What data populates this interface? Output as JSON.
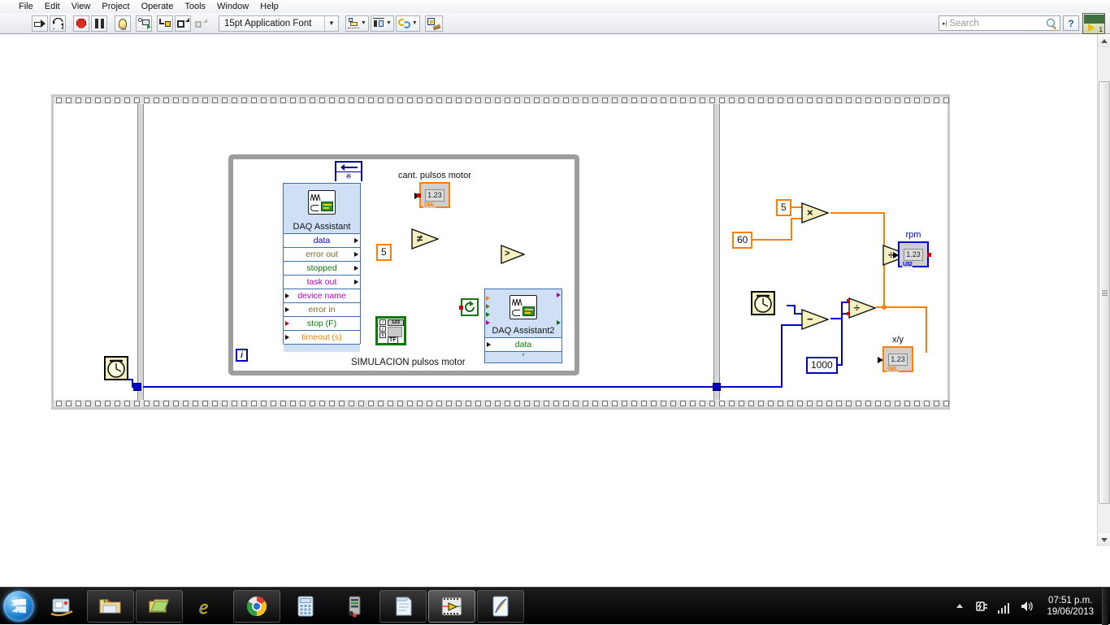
{
  "window": {
    "app": "LabVIEW Block Diagram",
    "menu": [
      "File",
      "Edit",
      "View",
      "Project",
      "Operate",
      "Tools",
      "Window",
      "Help"
    ]
  },
  "toolbar": {
    "buttons": [
      {
        "name": "run-button",
        "icon": "run-arrow-icon",
        "tip": "Run"
      },
      {
        "name": "run-continuously-button",
        "icon": "run-continuously-icon",
        "tip": "Run Continuously"
      },
      {
        "name": "abort-button",
        "icon": "abort-stop-icon",
        "tip": "Abort Execution"
      },
      {
        "name": "pause-button",
        "icon": "pause-icon",
        "tip": "Pause"
      },
      {
        "name": "highlight-execution-button",
        "icon": "lightbulb-icon",
        "tip": "Highlight Execution"
      },
      {
        "name": "retain-wire-values-button",
        "icon": "retain-wire-values-icon",
        "tip": "Retain Wire Values"
      },
      {
        "name": "step-into-button",
        "icon": "step-into-icon",
        "tip": "Step Into"
      },
      {
        "name": "step-over-button",
        "icon": "step-over-icon",
        "tip": "Step Over"
      },
      {
        "name": "step-out-button",
        "icon": "step-out-icon",
        "tip": "Step Out"
      }
    ],
    "font_selector": {
      "value": "15pt Application Font",
      "caret": "▼"
    },
    "align_label": "Align Objects",
    "distribute_label": "Distribute Objects",
    "reorder_label": "Reorder",
    "cleanup_label": "Clean Up Diagram"
  },
  "search": {
    "placeholder": "Search",
    "prefix": "▸|",
    "icon": "magnifier-icon"
  },
  "help_button": {
    "label": "?",
    "name": "context-help-button"
  },
  "vi_icon": {
    "connector_number": "1"
  },
  "diagram": {
    "structure": "flat-sequence",
    "frames": 3,
    "while_loop": {
      "label": "SIMULACION pulsos motor",
      "iteration_terminal": "i",
      "feedback_node_symbol": "※"
    },
    "express_vis": [
      {
        "name": "daq-assistant-1",
        "title": "DAQ Assistant",
        "terminals": [
          {
            "label": "data",
            "color": "#0000c8",
            "side": "out"
          },
          {
            "label": "error out",
            "color": "#7a6a20",
            "side": "out"
          },
          {
            "label": "stopped",
            "color": "#0a7a0a",
            "side": "out"
          },
          {
            "label": "task out",
            "color": "#b000b0",
            "side": "out"
          },
          {
            "label": "device name",
            "color": "#c000c0",
            "side": "in"
          },
          {
            "label": "error in",
            "color": "#7a6a20",
            "side": "in"
          },
          {
            "label": "stop (F)",
            "color": "#0a7a0a",
            "side": "in"
          },
          {
            "label": "timeout (s)",
            "color": "#ff8000",
            "side": "in"
          }
        ]
      },
      {
        "name": "daq-assistant-2",
        "title": "DAQ Assistant2",
        "terminals": [
          {
            "label": "data",
            "color": "#0a7a0a",
            "side": "in"
          }
        ]
      }
    ],
    "indicators": [
      {
        "name": "cant-pulsos-motor-indicator",
        "label": "cant. pulsos motor",
        "value": "1.23",
        "type": "DBL",
        "accent": "#ff8000"
      },
      {
        "name": "rpm-indicator",
        "label": "rpm",
        "value": "1.23",
        "type": "U32",
        "accent": "#0000d0"
      },
      {
        "name": "x-over-y-indicator",
        "label": "x/y",
        "value": "1.23",
        "type": "DBL",
        "accent": "#ff8000"
      }
    ],
    "constants": [
      {
        "name": "constant-5-loop",
        "value": "5",
        "accent": "#ff8000"
      },
      {
        "name": "constant-5-right",
        "value": "5",
        "accent": "#ff8000"
      },
      {
        "name": "constant-60",
        "value": "60",
        "accent": "#ff8000"
      },
      {
        "name": "constant-1000",
        "value": "1000",
        "accent": "#0000d0"
      }
    ],
    "primitives": [
      {
        "name": "not-equal-function",
        "symbol": "≠"
      },
      {
        "name": "greater-than-function",
        "symbol": ">"
      },
      {
        "name": "multiply-function",
        "symbol": "×"
      },
      {
        "name": "divide-function-rpm",
        "symbol": "÷"
      },
      {
        "name": "subtract-function",
        "symbol": "−"
      },
      {
        "name": "divide-function-time",
        "symbol": "÷"
      }
    ],
    "tick_count_nodes": [
      {
        "name": "tick-count-frame1"
      },
      {
        "name": "tick-count-frame3"
      }
    ],
    "misc_nodes": [
      {
        "name": "index-array-node",
        "glyphs": [
          "i",
          "j",
          "k"
        ],
        "numeric": "123",
        "bool": "TF"
      },
      {
        "name": "loop-boundary-node",
        "icon": "refresh-arrow-icon"
      }
    ]
  },
  "scrollbars": {
    "vertical": {
      "name": "vertical-scrollbar",
      "up": "▲",
      "down": "▼"
    },
    "horizontal": {
      "name": "horizontal-scrollbar"
    }
  },
  "taskbar": {
    "start": {
      "name": "start-button",
      "label": "Start"
    },
    "items": [
      {
        "name": "taskbar-item-media-center",
        "label": "Windows Media Center",
        "pinned": false
      },
      {
        "name": "taskbar-item-explorer",
        "label": "Windows Explorer",
        "pinned": true
      },
      {
        "name": "taskbar-item-folder",
        "label": "Folder",
        "pinned": true
      },
      {
        "name": "taskbar-item-internet-explorer",
        "label": "Internet Explorer",
        "pinned": false
      },
      {
        "name": "taskbar-item-chrome",
        "label": "Google Chrome",
        "pinned": true
      },
      {
        "name": "taskbar-item-calculator",
        "label": "Calculator",
        "pinned": false
      },
      {
        "name": "taskbar-item-computer",
        "label": "Computer",
        "pinned": false
      },
      {
        "name": "taskbar-item-notepad",
        "label": "Notepad",
        "pinned": true
      },
      {
        "name": "taskbar-item-labview",
        "label": "LabVIEW",
        "pinned": true,
        "active": true
      },
      {
        "name": "taskbar-item-paint",
        "label": "Paint",
        "pinned": true
      }
    ],
    "tray": {
      "show_hidden": "▲",
      "icons": [
        "power-plug-icon",
        "network-signal-icon",
        "volume-icon"
      ],
      "time": "07:51 p.m.",
      "date": "19/06/2013"
    }
  }
}
